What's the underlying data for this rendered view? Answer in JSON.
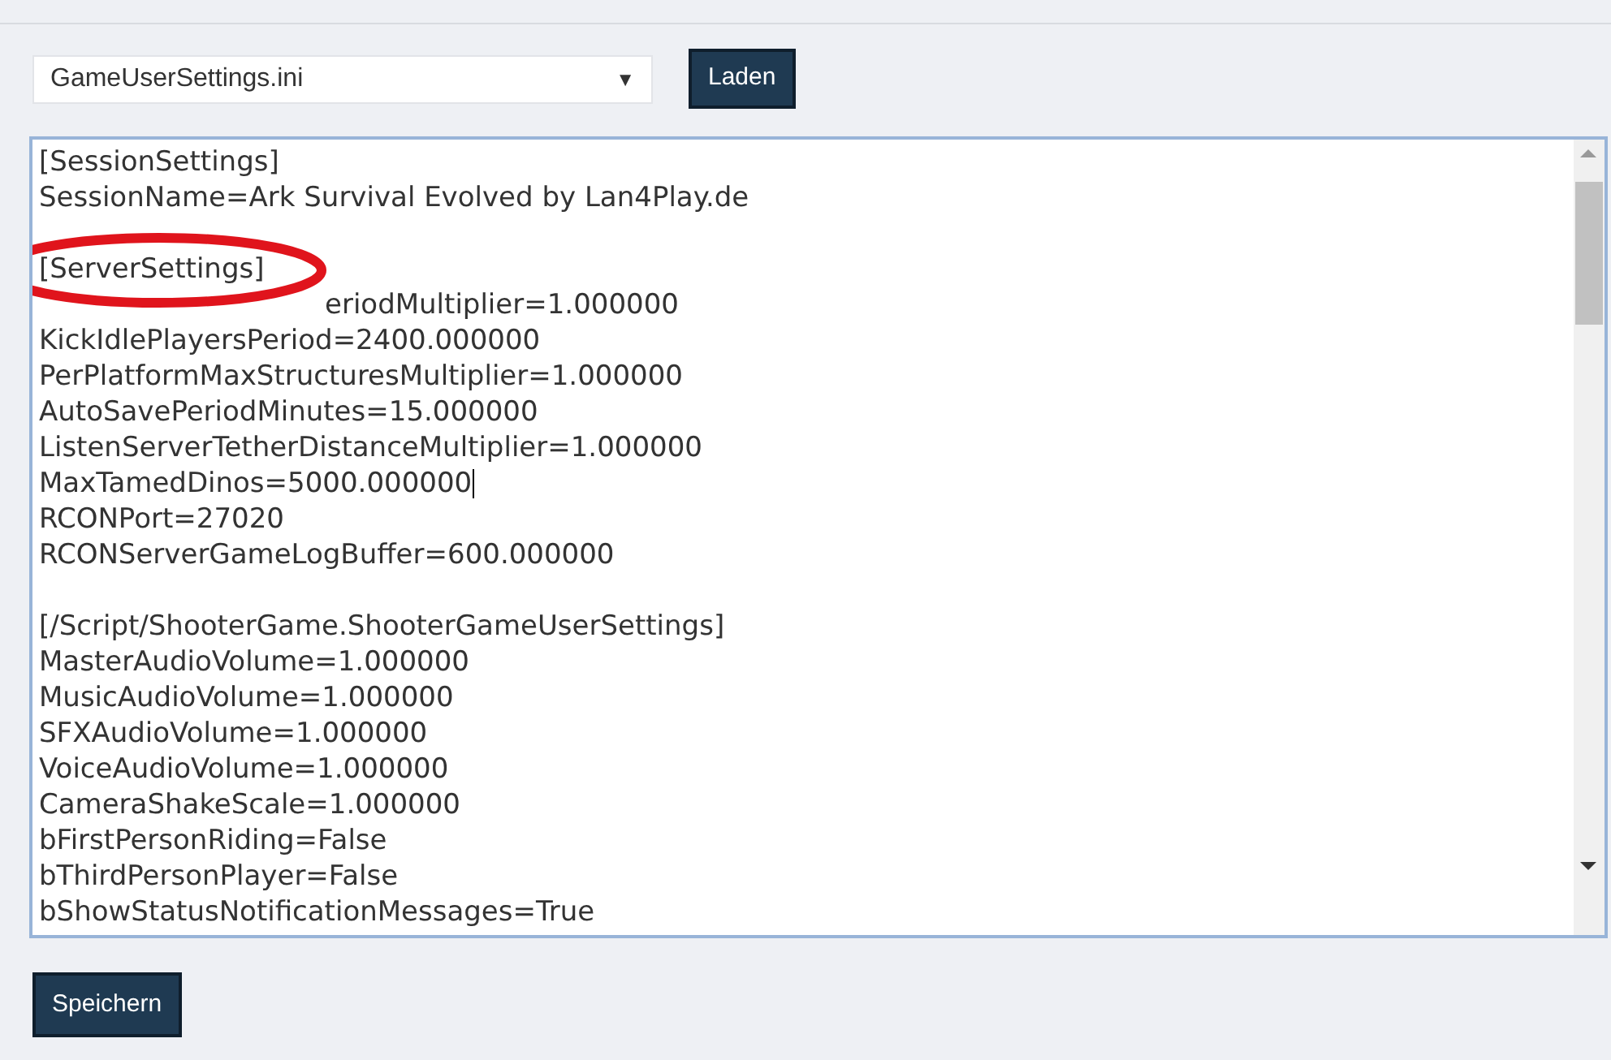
{
  "file_select": {
    "value": "GameUserSettings.ini",
    "arrow": "▼"
  },
  "load_button": {
    "label": "Laden"
  },
  "editor": {
    "sections": [
      {
        "lines": [
          {
            "text": "[SessionSettings]",
            "cursor": false,
            "kind": "plain"
          },
          {
            "text": "SessionName=Ark Survival Evolved by Lan4Play.de",
            "cursor": false,
            "kind": "plain"
          }
        ]
      },
      {
        "lines": [
          {
            "text": "[ServerSettings]",
            "cursor": false,
            "kind": "circled"
          },
          {
            "text": "eriodMultiplier=1.000000",
            "cursor": false,
            "kind": "covered"
          },
          {
            "text": "KickIdlePlayersPeriod=2400.000000",
            "cursor": false,
            "kind": "plain"
          },
          {
            "text": "PerPlatformMaxStructuresMultiplier=1.000000",
            "cursor": false,
            "kind": "plain"
          },
          {
            "text": "AutoSavePeriodMinutes=15.000000",
            "cursor": false,
            "kind": "plain"
          },
          {
            "text": "ListenServerTetherDistanceMultiplier=1.000000",
            "cursor": false,
            "kind": "plain"
          },
          {
            "text": "MaxTamedDinos=5000.000000",
            "cursor": true,
            "kind": "plain"
          },
          {
            "text": "RCONPort=27020",
            "cursor": false,
            "kind": "plain"
          },
          {
            "text": "RCONServerGameLogBuffer=600.000000",
            "cursor": false,
            "kind": "plain"
          }
        ]
      },
      {
        "lines": [
          {
            "text": "[/Script/ShooterGame.ShooterGameUserSettings]",
            "cursor": false,
            "kind": "plain"
          },
          {
            "text": "MasterAudioVolume=1.000000",
            "cursor": false,
            "kind": "plain"
          },
          {
            "text": "MusicAudioVolume=1.000000",
            "cursor": false,
            "kind": "plain"
          },
          {
            "text": "SFXAudioVolume=1.000000",
            "cursor": false,
            "kind": "plain"
          },
          {
            "text": "VoiceAudioVolume=1.000000",
            "cursor": false,
            "kind": "plain"
          },
          {
            "text": "CameraShakeScale=1.000000",
            "cursor": false,
            "kind": "plain"
          },
          {
            "text": "bFirstPersonRiding=False",
            "cursor": false,
            "kind": "plain"
          },
          {
            "text": "bThirdPersonPlayer=False",
            "cursor": false,
            "kind": "plain"
          },
          {
            "text": "bShowStatusNotificationMessages=True",
            "cursor": false,
            "kind": "plain"
          }
        ]
      }
    ]
  },
  "save_button": {
    "label": "Speichern"
  }
}
